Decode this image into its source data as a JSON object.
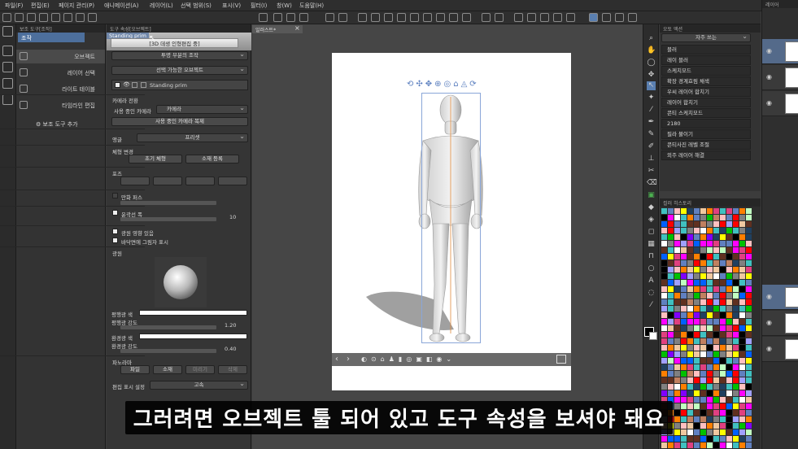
{
  "menubar": {
    "items": [
      "파일(F)",
      "편집(E)",
      "페이지 관리(P)",
      "애니메이션(A)",
      "레이어(L)",
      "선택 범위(S)",
      "표시(V)",
      "필터(I)",
      "창(W)",
      "도움말(H)"
    ]
  },
  "subtool_panel": {
    "tab_title": "보조 도구[조작]",
    "group_label": "조작",
    "items": [
      "오브젝트",
      "레이어 선택",
      "라이트 테이블",
      "타임라인 편집"
    ],
    "add_button": "보조 도구 추가"
  },
  "tool_props": {
    "tab_title": "도구 속성[오브젝트]",
    "object_name": "Standing prim",
    "tooltip": "[3D 데생 인형편집 중]",
    "transparent_dropdown": "투명 부분의 조작",
    "selectable_dropdown": "선택 가능한 오브젝트",
    "layer_row_name": "Standing prim",
    "camera_section": "카메라 전환",
    "camera_in_use_label": "사용 중인 카메라",
    "camera_value": "카메라",
    "camera_copy_button": "사용 중인 카메라 복제",
    "angle_label": "앵글",
    "angle_value": "프리셋",
    "bodyshape_section": "체형 변경",
    "bodyshape_initial_button": "초기 체형",
    "bodyshape_register_button": "소재 등록",
    "pose_section": "포즈",
    "manga_perspective_label": "만화 퍼스",
    "outline_width_label": "윤곽선 폭",
    "outline_width_value": "10",
    "light_affect_label": "광원 영향 있음",
    "floor_shadow_label": "바닥면에 그림자 표시",
    "light_section": "광원",
    "parallel_color_label": "평행광 색",
    "parallel_intensity_label": "평행광 강도",
    "parallel_intensity_value": "1.20",
    "ambient_color_label": "환경광 색",
    "ambient_intensity_label": "환경광 강도",
    "ambient_intensity_value": "0.40",
    "panorama_label": "파노라마",
    "panorama_buttons": [
      "파일",
      "소재",
      "미리기",
      "삭제"
    ],
    "edit_display_label": "편집 표시 설정",
    "edit_display_value": "고속"
  },
  "canvas": {
    "doc_tab": "일러스트*"
  },
  "auto_action": {
    "tab_title": "오토 액션",
    "set_name": "자주 쓰는",
    "items": [
      "블러",
      "레이 블러",
      "스케치모드",
      "확장 경계효림 채색",
      "우씨 레이어 합치기",
      "레이어 합치기",
      "콘티 스케치모드",
      "2180",
      "필라 불이기",
      "콘티사진 레벨 조절",
      "외주 레이어 해결"
    ]
  },
  "color_history": {
    "tab_title": "컬러 히스토리"
  },
  "layers": {
    "tab_title": "레이어"
  },
  "subtitle": "그러려면 오브젝트 툴 되어 있고 도구 속성을 보셔야 돼요"
}
